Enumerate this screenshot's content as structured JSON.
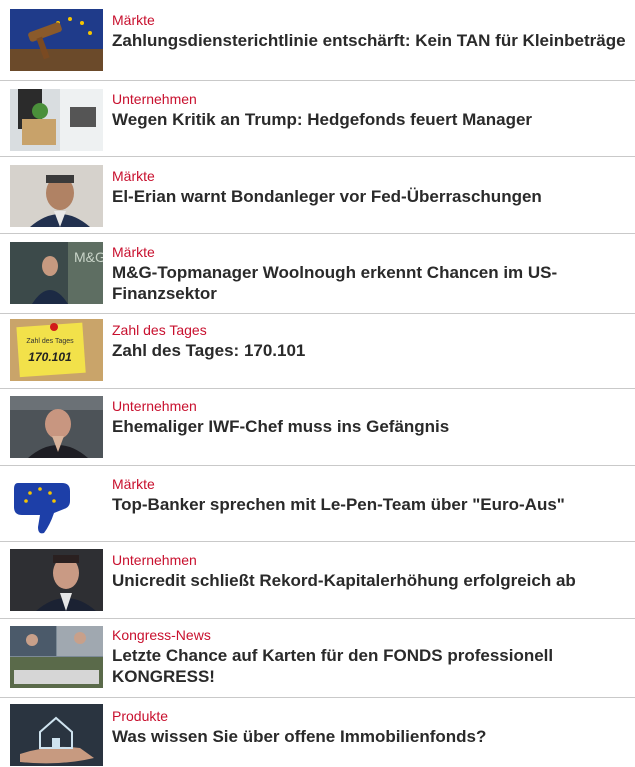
{
  "articles": [
    {
      "category": "Märkte",
      "title": "Zahlungsdiensterichtlinie entschärft: Kein TAN für Kleinbeträge",
      "image": "gavel-eu-flag-image"
    },
    {
      "category": "Unternehmen",
      "title": "Wegen Kritik an Trump: Hedgefonds feuert Manager",
      "image": "office-box-image"
    },
    {
      "category": "Märkte",
      "title": "El-Erian warnt Bondanleger vor Fed-Überraschungen",
      "image": "portrait-man-image"
    },
    {
      "category": "Märkte",
      "title": "M&G-Topmanager Woolnough erkennt Chancen im US-Finanzsektor",
      "image": "speaker-stage-image"
    },
    {
      "category": "Zahl des Tages",
      "title": "Zahl des Tages: 170.101",
      "image": "sticky-note-image",
      "note_head": "Zahl des Tages",
      "note_value": "170.101"
    },
    {
      "category": "Unternehmen",
      "title": "Ehemaliger IWF-Chef muss ins Gefängnis",
      "image": "man-praying-hands-image"
    },
    {
      "category": "Märkte",
      "title": "Top-Banker sprechen mit Le-Pen-Team über \"Euro-Aus\"",
      "image": "eu-thumbs-down-image"
    },
    {
      "category": "Unternehmen",
      "title": "Unicredit schließt Rekord-Kapitalerhöhung erfolgreich ab",
      "image": "portrait-executive-image"
    },
    {
      "category": "Kongress-News",
      "title": "Letzte Chance auf Karten für den FONDS professionell KONGRESS!",
      "image": "congress-collage-image"
    },
    {
      "category": "Produkte",
      "title": "Was wissen Sie über offene Immobilienfonds?",
      "image": "house-in-hand-image"
    }
  ]
}
